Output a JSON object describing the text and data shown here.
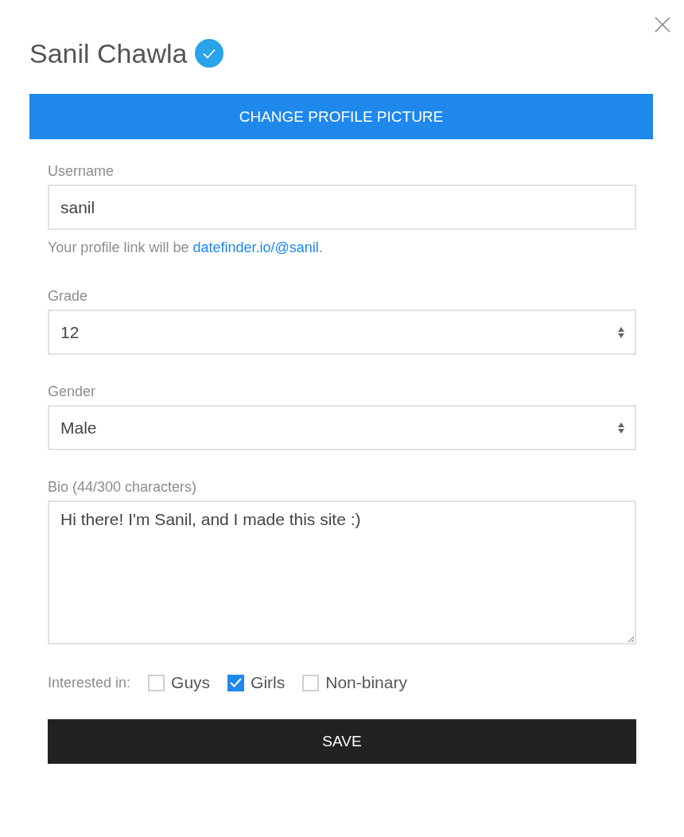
{
  "profile": {
    "name": "Sanil Chawla",
    "verified": true
  },
  "change_picture_button": "CHANGE PROFILE PICTURE",
  "username": {
    "label": "Username",
    "value": "sanil",
    "help_prefix": "Your profile link will be ",
    "help_link": "datefinder.io/@sanil",
    "help_suffix": "."
  },
  "grade": {
    "label": "Grade",
    "value": "12"
  },
  "gender": {
    "label": "Gender",
    "value": "Male"
  },
  "bio": {
    "label": "Bio (44/300 characters)",
    "value": "Hi there! I'm Sanil, and I made this site :)"
  },
  "interested": {
    "label": "Interested in:",
    "options": [
      {
        "label": "Guys",
        "checked": false
      },
      {
        "label": "Girls",
        "checked": true
      },
      {
        "label": "Non-binary",
        "checked": false
      }
    ]
  },
  "save_button": "SAVE"
}
